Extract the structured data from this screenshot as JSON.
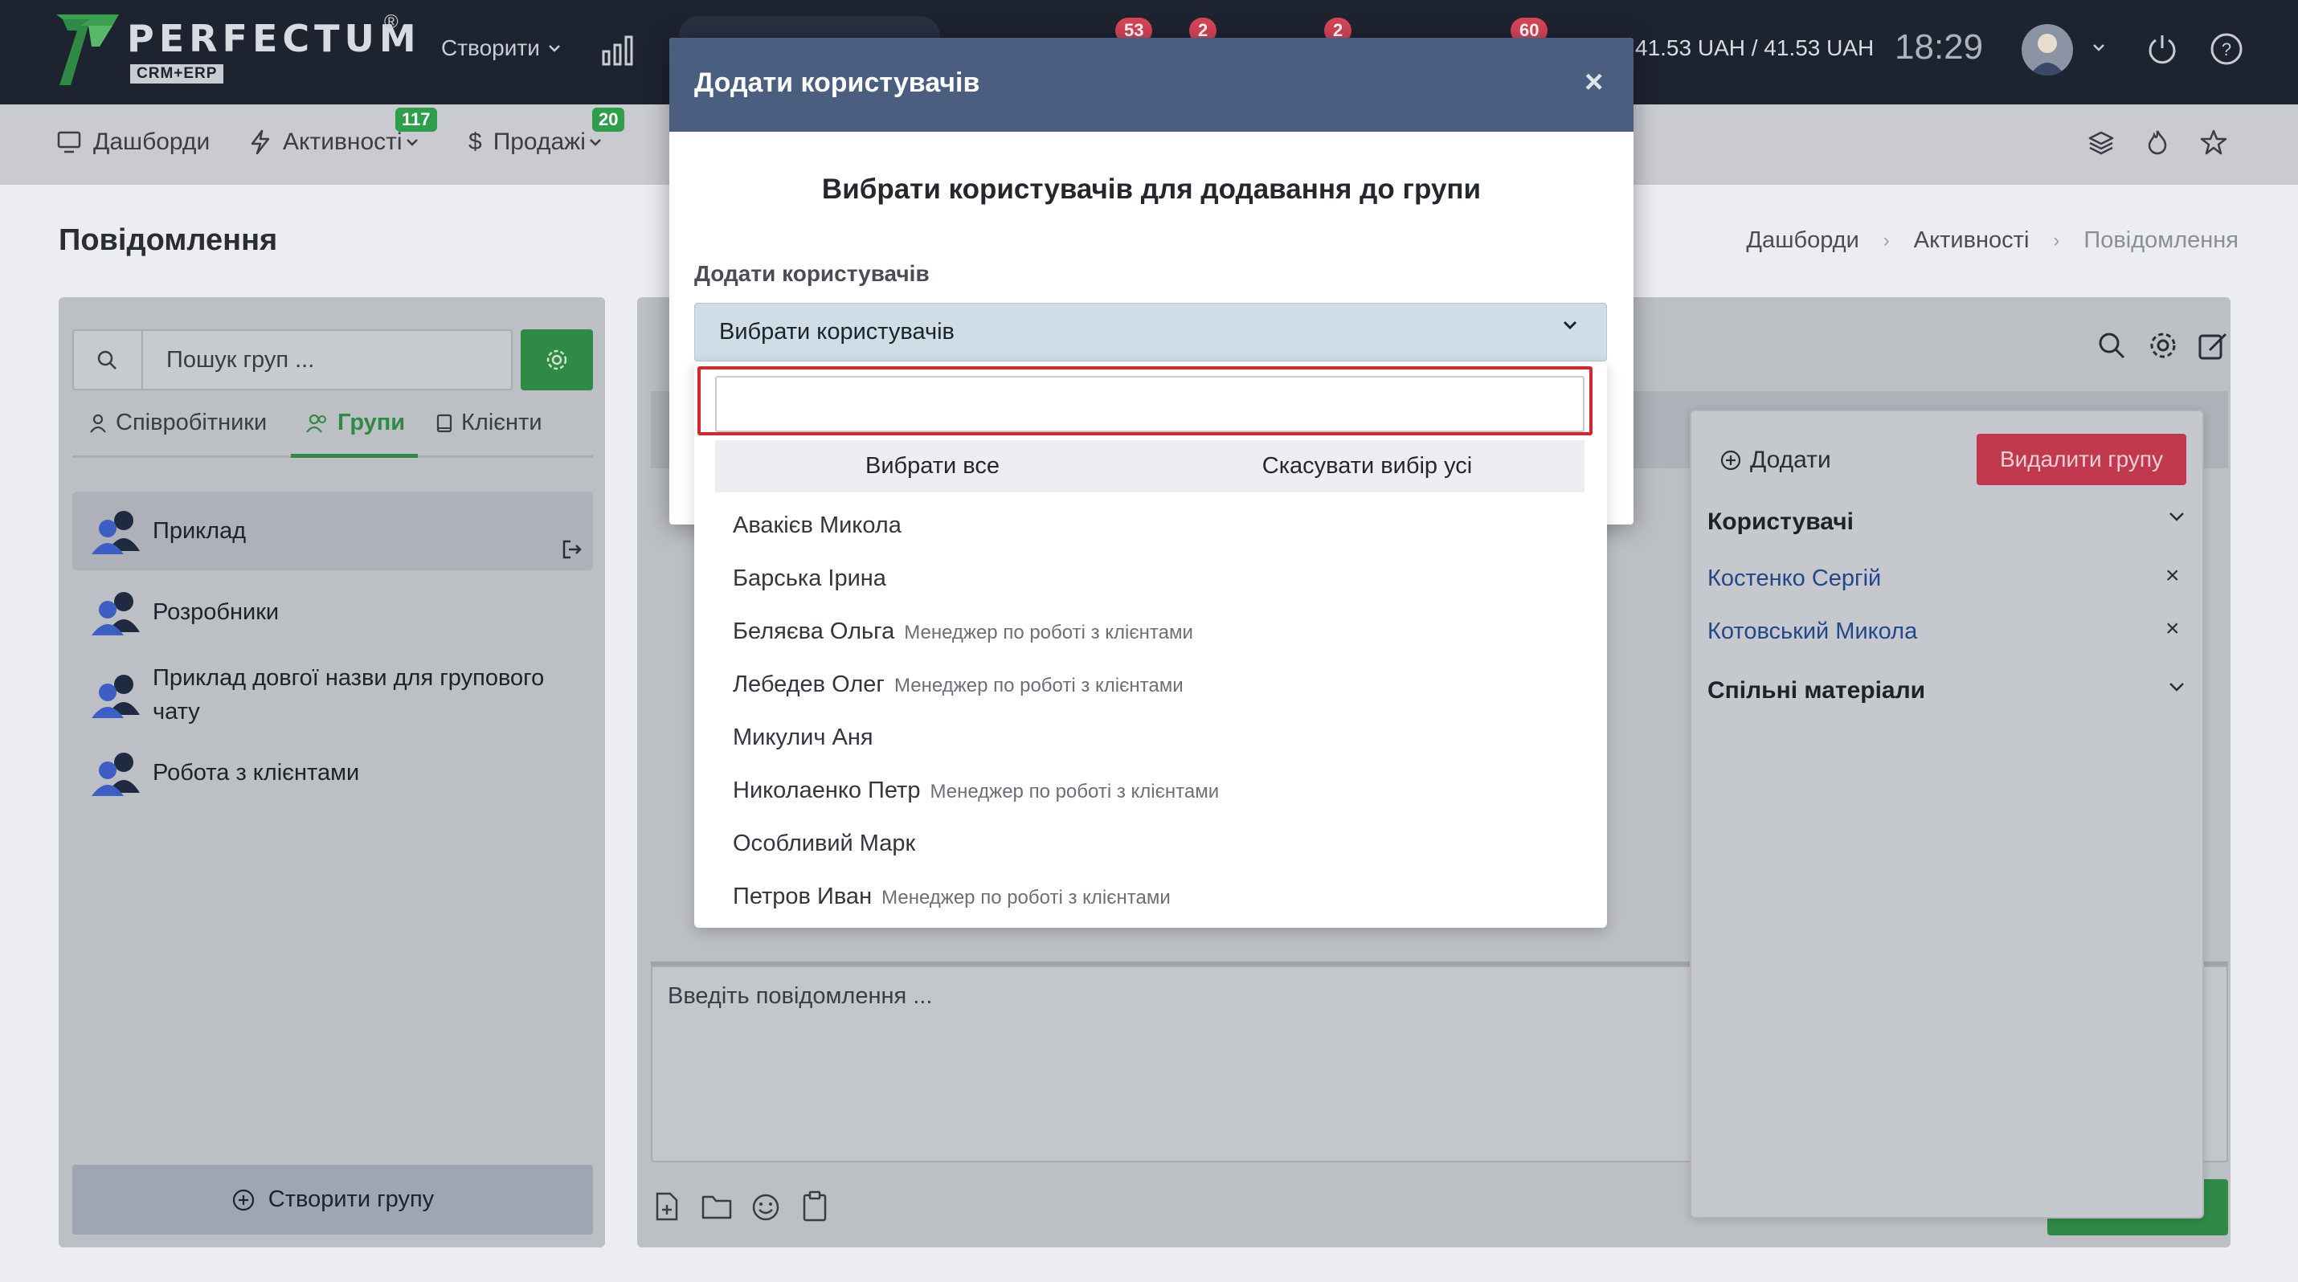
{
  "brand": {
    "name": "PERFECTUM",
    "sub": "CRM+ERP",
    "reg": "®"
  },
  "topbar": {
    "create_label": "Створити",
    "badges": [
      "53",
      "2",
      "2",
      "60"
    ],
    "currency": "41.53 UAH / 41.53 UAH",
    "time": "18:29"
  },
  "nav": {
    "items": [
      {
        "label": "Дашборди"
      },
      {
        "label": "Активності",
        "badge": "117"
      },
      {
        "label": "Продажі",
        "badge": "20"
      }
    ]
  },
  "page": {
    "title": "Повідомлення",
    "breadcrumbs": [
      "Дашборди",
      "Активності",
      "Повідомлення"
    ]
  },
  "left": {
    "search_placeholder": "Пошук груп ...",
    "tabs": [
      "Співробітники",
      "Групи",
      "Клієнти"
    ],
    "groups": [
      "Приклад",
      "Розробники",
      "Приклад довгої назви для групового чату",
      "Робота з клієнтами"
    ],
    "create_group": "Створити групу"
  },
  "chat": {
    "input_placeholder": "Введіть повідомлення ..."
  },
  "side": {
    "add_label": "Додати",
    "delete_label": "Видалити групу",
    "users_title": "Користувачі",
    "users": [
      "Костенко Сергій",
      "Котовський Микола"
    ],
    "shared_title": "Спільні матеріали"
  },
  "modal": {
    "title": "Додати користувачів",
    "close": "×",
    "subtitle": "Вибрати користувачів для додавання до групи",
    "field_label": "Додати користувачів",
    "select_value": "Вибрати користувачів",
    "select_all": "Вибрати все",
    "deselect_all": "Скасувати вибір усі",
    "options": [
      {
        "name": "Авакієв Микола",
        "role": ""
      },
      {
        "name": "Барська Ірина",
        "role": ""
      },
      {
        "name": "Беляєва Ольга",
        "role": "Менеджер по роботі з клієнтами"
      },
      {
        "name": "Лебедев Олег",
        "role": "Менеджер по роботі з клієнтами"
      },
      {
        "name": "Микулич Аня",
        "role": ""
      },
      {
        "name": "Николаенко Петр",
        "role": "Менеджер по роботі з клієнтами"
      },
      {
        "name": "Особливий Марк",
        "role": ""
      },
      {
        "name": "Петров Иван",
        "role": "Менеджер по роботі з клієнтами"
      }
    ]
  },
  "colors": {
    "brand_green": "#2f8a45",
    "danger": "#c0394d",
    "modal_header": "#4a5e7f",
    "highlight_red": "#d8262d"
  }
}
